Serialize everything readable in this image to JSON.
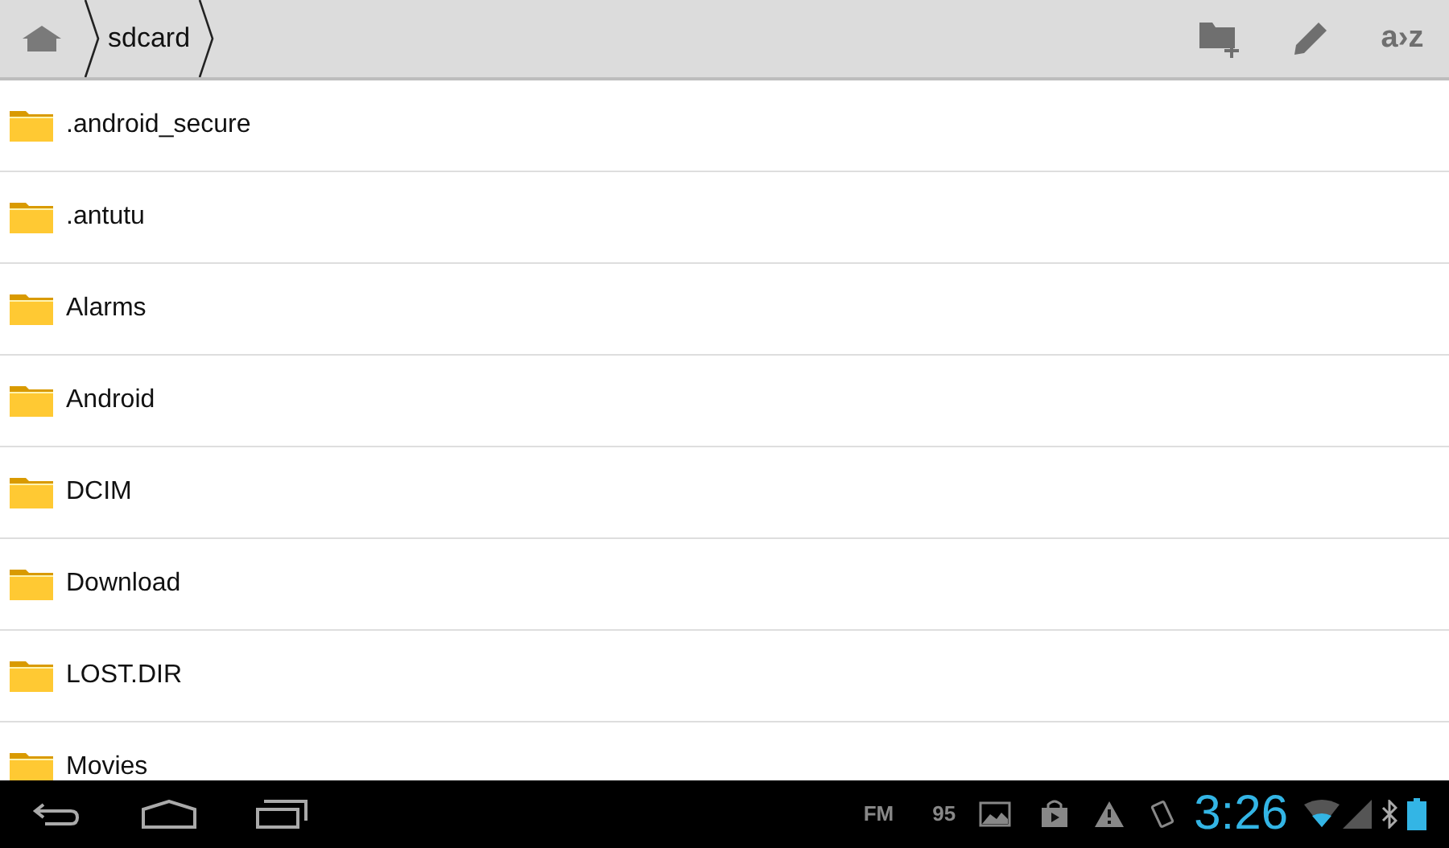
{
  "breadcrumb": [
    {
      "label": "sdcard"
    }
  ],
  "toolbar": {
    "sort_label": "a›z"
  },
  "files": [
    {
      "name": ".android_secure"
    },
    {
      "name": ".antutu"
    },
    {
      "name": "Alarms"
    },
    {
      "name": "Android"
    },
    {
      "name": "DCIM"
    },
    {
      "name": "Download"
    },
    {
      "name": "LOST.DIR"
    },
    {
      "name": "Movies"
    }
  ],
  "status_bar": {
    "notifications": [
      "FM",
      "95"
    ],
    "time": "3:26"
  }
}
